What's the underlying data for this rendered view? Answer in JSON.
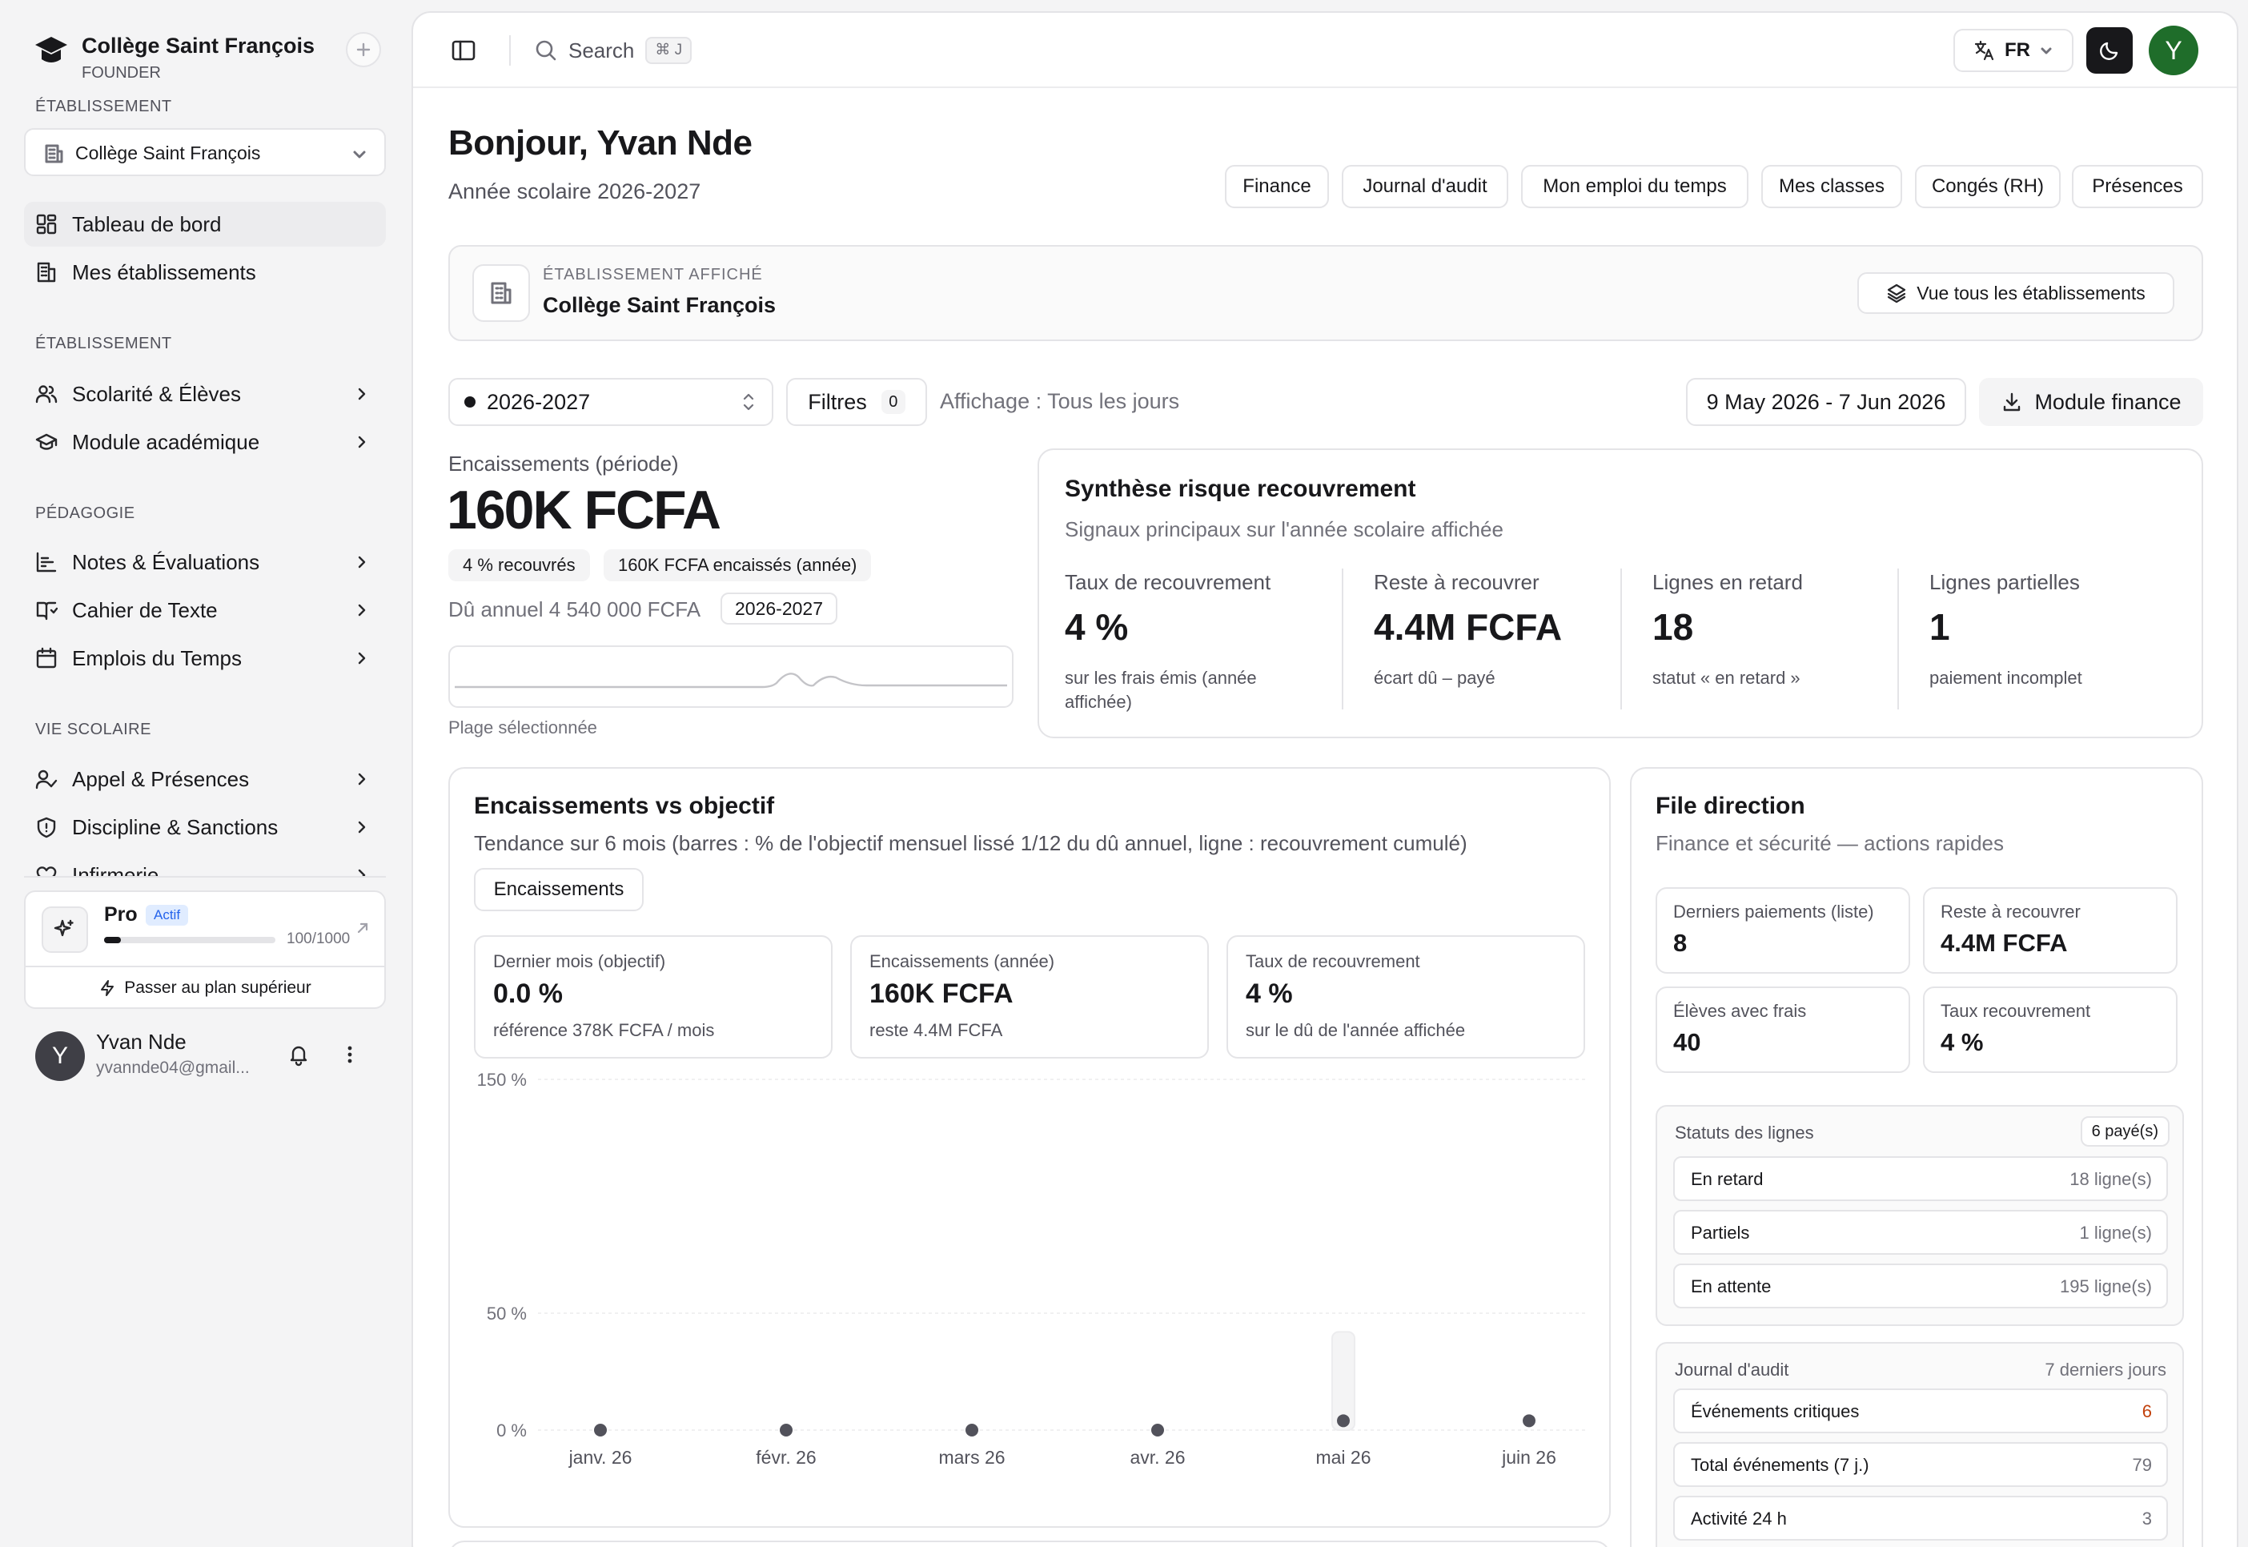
{
  "sidebar": {
    "school_name": "Collège Saint François",
    "role": "FOUNDER",
    "section_etablissement_top": "ÉTABLISSEMENT",
    "selected_school": "Collège Saint François",
    "nav_top": [
      {
        "label": "Tableau de bord",
        "icon": "dashboard-icon",
        "active": true
      },
      {
        "label": "Mes établissements",
        "icon": "building-icon"
      }
    ],
    "section_etablissement": "ÉTABLISSEMENT",
    "nav_etab": [
      {
        "label": "Scolarité & Élèves",
        "icon": "users-icon"
      },
      {
        "label": "Module académique",
        "icon": "graduation-cap-icon"
      }
    ],
    "section_pedagogie": "PÉDAGOGIE",
    "nav_peda": [
      {
        "label": "Notes & Évaluations",
        "icon": "chart-list-icon"
      },
      {
        "label": "Cahier de Texte",
        "icon": "book-icon"
      },
      {
        "label": "Emplois du Temps",
        "icon": "calendar-icon"
      }
    ],
    "section_vie": "VIE SCOLAIRE",
    "nav_vie": [
      {
        "label": "Appel & Présences",
        "icon": "user-check-icon"
      },
      {
        "label": "Discipline & Sanctions",
        "icon": "shield-icon"
      },
      {
        "label": "Infirmerie",
        "icon": "heart-icon"
      }
    ],
    "plan": {
      "name": "Pro",
      "status": "Actif",
      "usage_text": "100/1000",
      "usage_fraction": 0.1,
      "upgrade_label": "Passer au plan supérieur"
    },
    "user": {
      "initial": "Y",
      "name": "Yvan Nde",
      "email": "yvannde04@gmail..."
    }
  },
  "topbar": {
    "search_placeholder": "Search",
    "shortcut": "⌘ J",
    "language": "FR",
    "avatar_initial": "Y"
  },
  "header": {
    "greeting": "Bonjour, Yvan Nde",
    "school_year": "Année scolaire 2026-2027",
    "quick_links": [
      "Finance",
      "Journal d'audit",
      "Mon emploi du temps",
      "Mes classes",
      "Congés (RH)",
      "Présences"
    ]
  },
  "displayed_school": {
    "label": "ÉTABLISSEMENT AFFICHÉ",
    "name": "Collège Saint François",
    "view_all": "Vue tous les établissements"
  },
  "filters": {
    "year": "2026-2027",
    "filters_label": "Filtres",
    "filters_count": "0",
    "display_mode": "Affichage : Tous les jours",
    "date_range": "9 May 2026 - 7 Jun 2026",
    "finance_module": "Module finance"
  },
  "collections": {
    "label": "Encaissements (période)",
    "value": "160K FCFA",
    "badge_recovered": "4 % recouvrés",
    "badge_year": "160K FCFA encaissés (année)",
    "annual_due": "Dû annuel 4 540 000 FCFA",
    "annual_year": "2026-2027",
    "range_label": "Plage sélectionnée"
  },
  "risk": {
    "title": "Synthèse risque recouvrement",
    "subtitle": "Signaux principaux sur l'année scolaire affichée",
    "metrics": [
      {
        "label": "Taux de recouvrement",
        "value": "4 %",
        "note": "sur les frais émis (année affichée)"
      },
      {
        "label": "Reste à recouvrer",
        "value": "4.4M FCFA",
        "note": "écart dû – payé"
      },
      {
        "label": "Lignes en retard",
        "value": "18",
        "note": "statut « en retard »"
      },
      {
        "label": "Lignes partielles",
        "value": "1",
        "note": "paiement incomplet"
      }
    ]
  },
  "objective": {
    "title": "Encaissements vs objectif",
    "subtitle": "Tendance sur 6 mois (barres : % de l'objectif mensuel lissé 1/12 du dû annuel, ligne : recouvrement cumulé)",
    "tab": "Encaissements",
    "kpis": [
      {
        "label": "Dernier mois (objectif)",
        "value": "0.0 %",
        "note": "référence 378K FCFA / mois"
      },
      {
        "label": "Encaissements (année)",
        "value": "160K FCFA",
        "note": "reste 4.4M FCFA"
      },
      {
        "label": "Taux de recouvrement",
        "value": "4 %",
        "note": "sur le dû de l'année affichée"
      }
    ]
  },
  "chart_data": {
    "type": "bar",
    "categories": [
      "janv. 26",
      "févr. 26",
      "mars 26",
      "avr. 26",
      "mai 26",
      "juin 26"
    ],
    "series": [
      {
        "type": "bar",
        "values": [
          0,
          0,
          0,
          0,
          42,
          0
        ]
      },
      {
        "type": "line",
        "values": [
          0,
          0,
          0,
          0,
          4,
          4
        ]
      }
    ],
    "y_ticks": [
      "0 %",
      "50 %",
      "150 %"
    ],
    "ylim": [
      0,
      150
    ],
    "grid": true,
    "accent": "#e4e4e7"
  },
  "direction": {
    "title": "File direction",
    "subtitle": "Finance et sécurité — actions rapides",
    "stats": [
      {
        "label": "Derniers paiements (liste)",
        "value": "8"
      },
      {
        "label": "Reste à recouvrer",
        "value": "4.4M FCFA"
      },
      {
        "label": "Élèves avec frais",
        "value": "40"
      },
      {
        "label": "Taux recouvrement",
        "value": "4 %"
      }
    ],
    "statuses_title": "Statuts des lignes",
    "statuses_badge": "6 payé(s)",
    "statuses": [
      {
        "label": "En retard",
        "value": "18 ligne(s)"
      },
      {
        "label": "Partiels",
        "value": "1 ligne(s)"
      },
      {
        "label": "En attente",
        "value": "195 ligne(s)"
      }
    ],
    "audit_title": "Journal d'audit",
    "audit_period": "7 derniers jours",
    "audit": [
      {
        "label": "Événements critiques",
        "value": "6",
        "color": "#c2410c"
      },
      {
        "label": "Total événements (7 j.)",
        "value": "79"
      },
      {
        "label": "Activité 24 h",
        "value": "3"
      }
    ]
  }
}
